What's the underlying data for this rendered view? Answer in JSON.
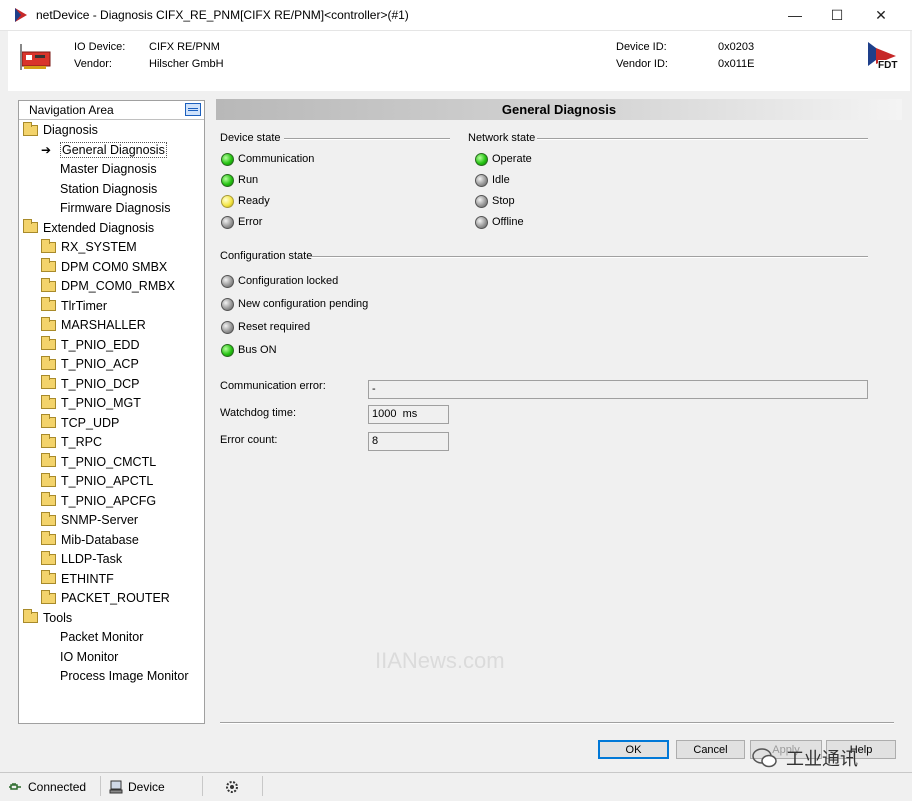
{
  "window": {
    "title": "netDevice - Diagnosis CIFX_RE_PNM[CIFX RE/PNM]<controller>(#1)",
    "minimize": "—",
    "maximize": "☐",
    "close": "✕"
  },
  "header": {
    "io_device_label": "IO Device:",
    "io_device_value": "CIFX RE/PNM",
    "vendor_label": "Vendor:",
    "vendor_value": "Hilscher GmbH",
    "device_id_label": "Device ID:",
    "device_id_value": "0x0203",
    "vendor_id_label": "Vendor ID:",
    "vendor_id_value": "0x011E",
    "logo_text": "FDT"
  },
  "nav": {
    "title": "Navigation Area",
    "items": [
      {
        "label": "Diagnosis",
        "level": 0,
        "icon": "folder-open-icon"
      },
      {
        "label": "General Diagnosis",
        "level": 1,
        "icon": "arrow-icon",
        "selected": true
      },
      {
        "label": "Master Diagnosis",
        "level": 1,
        "icon": "none"
      },
      {
        "label": "Station Diagnosis",
        "level": 1,
        "icon": "none"
      },
      {
        "label": "Firmware Diagnosis",
        "level": 1,
        "icon": "none"
      },
      {
        "label": "Extended Diagnosis",
        "level": 0,
        "icon": "folder-open-icon"
      },
      {
        "label": "RX_SYSTEM",
        "level": 1,
        "icon": "folder-icon"
      },
      {
        "label": "DPM COM0 SMBX",
        "level": 1,
        "icon": "folder-icon"
      },
      {
        "label": "DPM_COM0_RMBX",
        "level": 1,
        "icon": "folder-icon"
      },
      {
        "label": "TlrTimer",
        "level": 1,
        "icon": "folder-icon"
      },
      {
        "label": "MARSHALLER",
        "level": 1,
        "icon": "folder-icon"
      },
      {
        "label": "T_PNIO_EDD",
        "level": 1,
        "icon": "folder-icon"
      },
      {
        "label": "T_PNIO_ACP",
        "level": 1,
        "icon": "folder-icon"
      },
      {
        "label": "T_PNIO_DCP",
        "level": 1,
        "icon": "folder-icon"
      },
      {
        "label": "T_PNIO_MGT",
        "level": 1,
        "icon": "folder-icon"
      },
      {
        "label": "TCP_UDP",
        "level": 1,
        "icon": "folder-icon"
      },
      {
        "label": "T_RPC",
        "level": 1,
        "icon": "folder-icon"
      },
      {
        "label": "T_PNIO_CMCTL",
        "level": 1,
        "icon": "folder-icon"
      },
      {
        "label": "T_PNIO_APCTL",
        "level": 1,
        "icon": "folder-icon"
      },
      {
        "label": "T_PNIO_APCFG",
        "level": 1,
        "icon": "folder-icon"
      },
      {
        "label": "SNMP-Server",
        "level": 1,
        "icon": "folder-icon"
      },
      {
        "label": "Mib-Database",
        "level": 1,
        "icon": "folder-icon"
      },
      {
        "label": "LLDP-Task",
        "level": 1,
        "icon": "folder-icon"
      },
      {
        "label": "ETHINTF",
        "level": 1,
        "icon": "folder-icon"
      },
      {
        "label": "PACKET_ROUTER",
        "level": 1,
        "icon": "folder-icon"
      },
      {
        "label": "Tools",
        "level": 0,
        "icon": "folder-open-icon"
      },
      {
        "label": "Packet Monitor",
        "level": 1,
        "icon": "none"
      },
      {
        "label": "IO Monitor",
        "level": 1,
        "icon": "none"
      },
      {
        "label": "Process Image Monitor",
        "level": 1,
        "icon": "none"
      }
    ]
  },
  "main": {
    "title": "General Diagnosis",
    "device_state": {
      "label": "Device state",
      "items": [
        {
          "label": "Communication",
          "status": "green"
        },
        {
          "label": "Run",
          "status": "green"
        },
        {
          "label": "Ready",
          "status": "yellow"
        },
        {
          "label": "Error",
          "status": "grey"
        }
      ]
    },
    "network_state": {
      "label": "Network state",
      "items": [
        {
          "label": "Operate",
          "status": "green"
        },
        {
          "label": "Idle",
          "status": "grey"
        },
        {
          "label": "Stop",
          "status": "grey"
        },
        {
          "label": "Offline",
          "status": "grey"
        }
      ]
    },
    "configuration_state": {
      "label": "Configuration state",
      "items": [
        {
          "label": "Configuration locked",
          "status": "grey"
        },
        {
          "label": "New configuration pending",
          "status": "grey"
        },
        {
          "label": "Reset required",
          "status": "grey"
        },
        {
          "label": "Bus ON",
          "status": "green"
        }
      ]
    },
    "communication_error_label": "Communication error:",
    "communication_error_value": "-",
    "watchdog_label": "Watchdog time:",
    "watchdog_value": "1000  ms",
    "error_count_label": "Error count:",
    "error_count_value": "8"
  },
  "buttons": {
    "ok": "OK",
    "cancel": "Cancel",
    "apply": "Apply",
    "help": "Help"
  },
  "status_bar": {
    "connected": "Connected",
    "device": "Device"
  },
  "overlay": {
    "watermark": "IIANews.com",
    "wechat": "工业通讯"
  },
  "colors": {
    "led_green": "#27c414",
    "led_grey": "#9a9a9a",
    "led_yellow": "#f4e64a",
    "ok_border": "#0078d7"
  }
}
